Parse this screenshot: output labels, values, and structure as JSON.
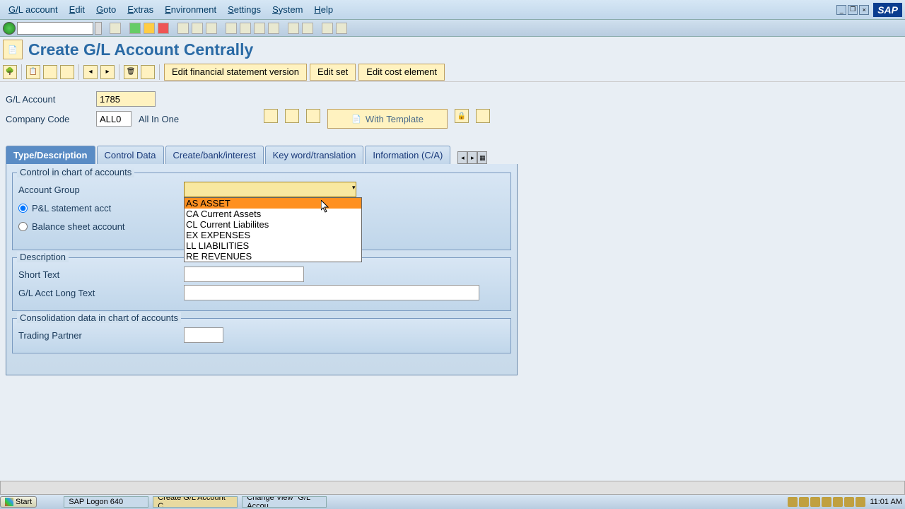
{
  "menu": {
    "items": [
      "G/L account",
      "Edit",
      "Goto",
      "Extras",
      "Environment",
      "Settings",
      "System",
      "Help"
    ]
  },
  "page_title": "Create G/L Account Centrally",
  "toolbar2": {
    "buttons": [
      "Edit financial statement version",
      "Edit set",
      "Edit cost element"
    ]
  },
  "form": {
    "gl_account_label": "G/L Account",
    "gl_account_value": "1785",
    "company_code_label": "Company Code",
    "company_code_value": "ALL0",
    "company_code_desc": "All In One",
    "with_template_label": "With Template"
  },
  "tabs": [
    "Type/Description",
    "Control Data",
    "Create/bank/interest",
    "Key word/translation",
    "Information (C/A)"
  ],
  "section1": {
    "title": "Control in chart of accounts",
    "account_group_label": "Account Group",
    "radio_pl": "P&L statement acct",
    "radio_bs": "Balance sheet account",
    "account_group_value": "",
    "options": [
      "AS ASSET",
      "CA Current Assets",
      "CL Current Liabilites",
      "EX EXPENSES",
      "LL LIABILITIES",
      "RE REVENUES"
    ]
  },
  "section2": {
    "title": "Description",
    "short_text_label": "Short Text",
    "short_text_value": "",
    "long_text_label": "G/L Acct Long Text",
    "long_text_value": ""
  },
  "section3": {
    "title": "Consolidation data in chart of accounts",
    "trading_partner_label": "Trading Partner",
    "trading_partner_value": ""
  },
  "taskbar": {
    "start": "Start",
    "items": [
      "SAP Logon 640",
      "Create G/L Account C...",
      "Change View \"G/L Accou..."
    ],
    "time": "11:01 AM"
  },
  "sap_logo": "SAP"
}
